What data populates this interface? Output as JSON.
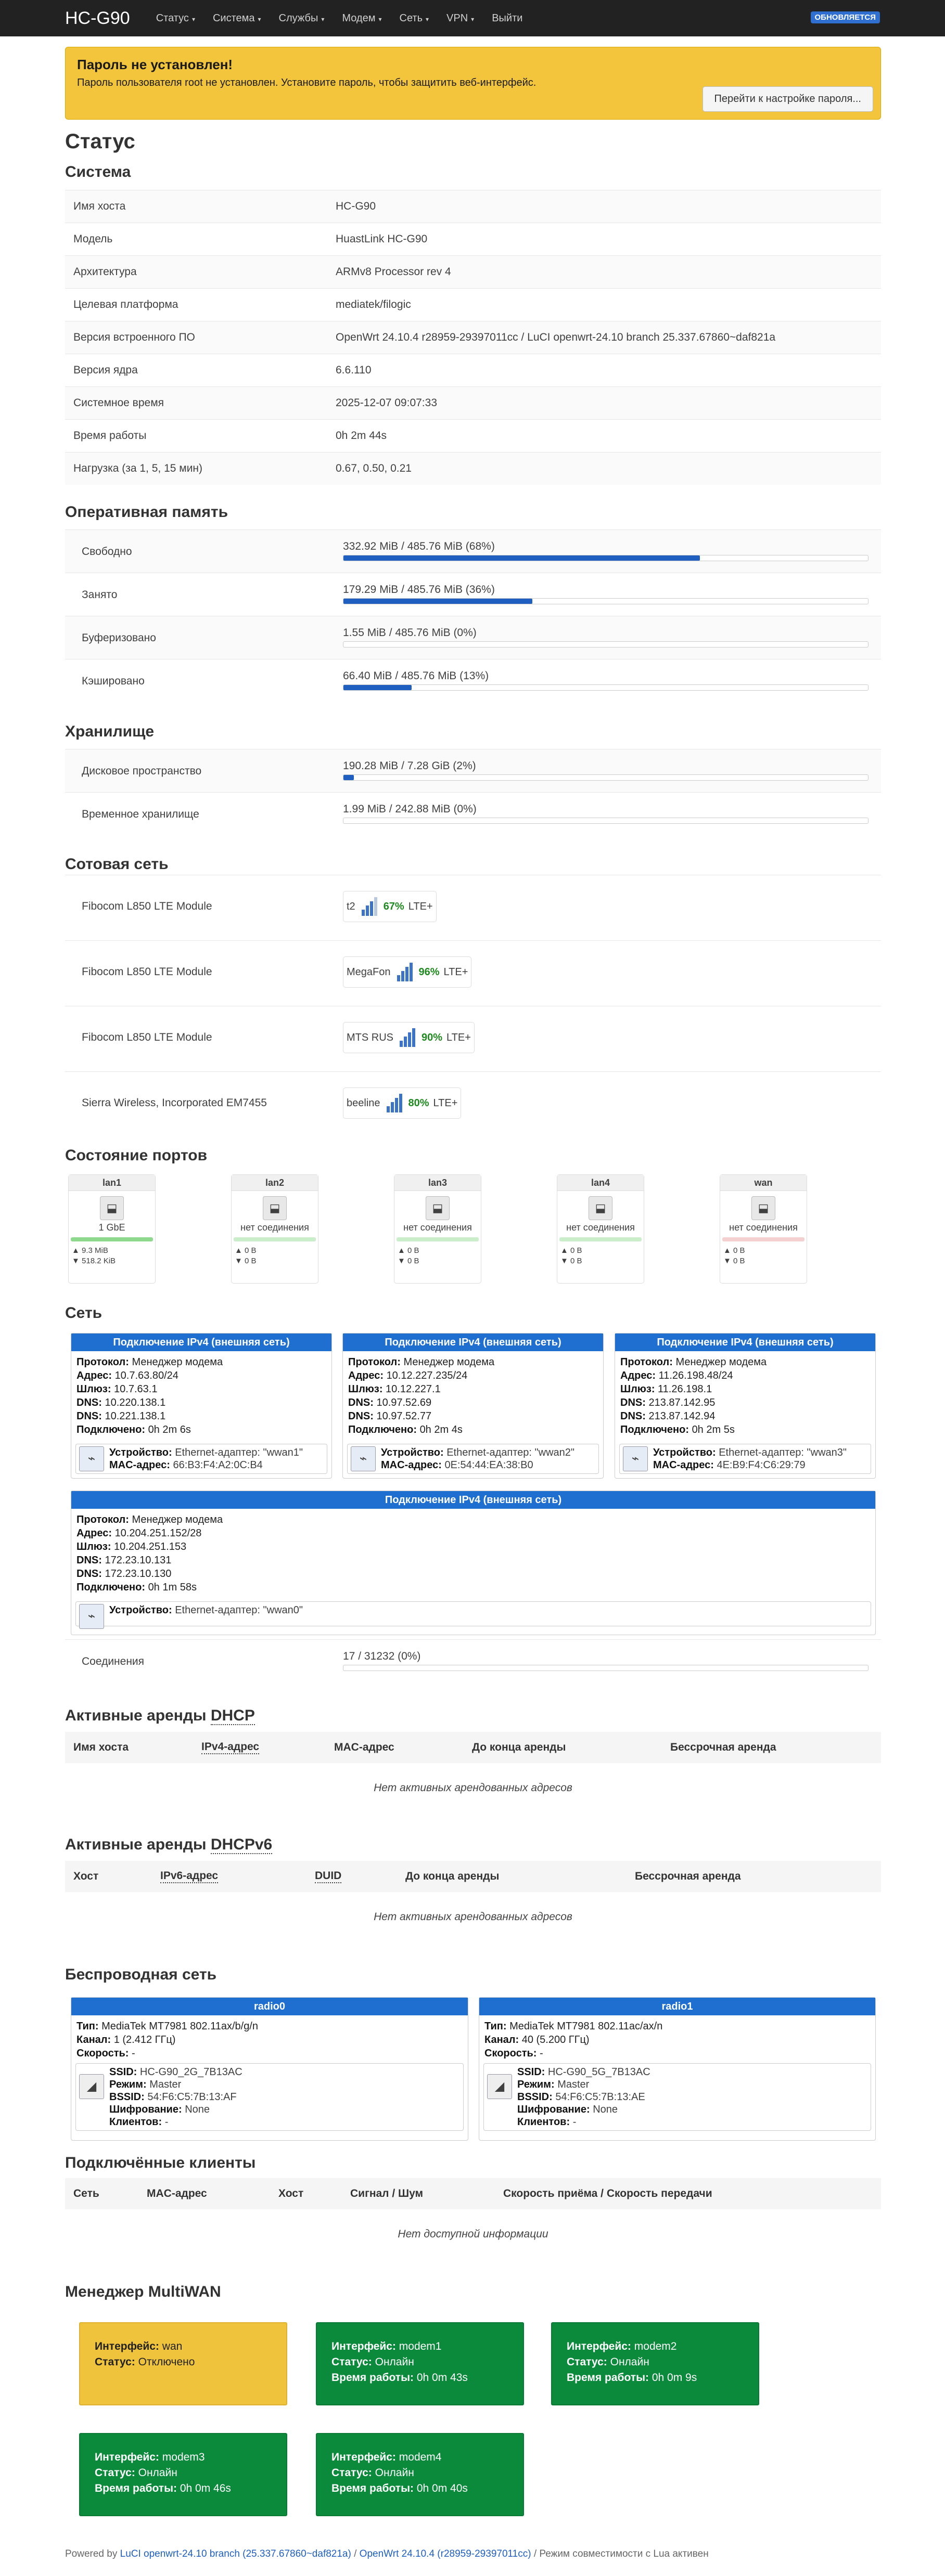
{
  "nav": {
    "brand": "HC-G90",
    "items": [
      "Статус",
      "Система",
      "Службы",
      "Модем",
      "Сеть",
      "VPN",
      "Выйти"
    ],
    "status_badge": "ОБНОВЛЯЕТСЯ"
  },
  "alert": {
    "title": "Пароль не установлен!",
    "text": "Пароль пользователя root не установлен. Установите пароль, чтобы защитить веб-интерфейс.",
    "button": "Перейти к настройке пароля..."
  },
  "page_title": "Статус",
  "system": {
    "heading": "Система",
    "rows": [
      {
        "k": "Имя хоста",
        "v": "HC-G90"
      },
      {
        "k": "Модель",
        "v": "HuastLink HC-G90"
      },
      {
        "k": "Архитектура",
        "v": "ARMv8 Processor rev 4"
      },
      {
        "k": "Целевая платформа",
        "v": "mediatek/filogic"
      },
      {
        "k": "Версия встроенного ПО",
        "v": "OpenWrt 24.10.4 r28959-29397011cc / LuCI openwrt-24.10 branch 25.337.67860~daf821a"
      },
      {
        "k": "Версия ядра",
        "v": "6.6.110"
      },
      {
        "k": "Системное время",
        "v": "2025-12-07 09:07:33"
      },
      {
        "k": "Время работы",
        "v": "0h 2m 44s"
      },
      {
        "k": "Нагрузка (за 1, 5, 15 мин)",
        "v": "0.67, 0.50, 0.21"
      }
    ]
  },
  "memory": {
    "heading": "Оперативная память",
    "rows": [
      {
        "k": "Свободно",
        "v": "332.92 MiB / 485.76 MiB (68%)",
        "pct": 68
      },
      {
        "k": "Занято",
        "v": "179.29 MiB / 485.76 MiB (36%)",
        "pct": 36
      },
      {
        "k": "Буферизовано",
        "v": "1.55 MiB / 485.76 MiB (0%)",
        "pct": 0
      },
      {
        "k": "Кэшировано",
        "v": "66.40 MiB / 485.76 MiB (13%)",
        "pct": 13
      }
    ]
  },
  "storage": {
    "heading": "Хранилище",
    "rows": [
      {
        "k": "Дисковое пространство",
        "v": "190.28 MiB / 7.28 GiB (2%)",
        "pct": 2
      },
      {
        "k": "Временное хранилище",
        "v": "1.99 MiB / 242.88 MiB (0%)",
        "pct": 0
      }
    ]
  },
  "cellular": {
    "heading": "Сотовая сеть",
    "rows": [
      {
        "k": "Fibocom L850 LTE Module",
        "op": "t2",
        "pct": "67%",
        "tech": "LTE+"
      },
      {
        "k": "Fibocom L850 LTE Module",
        "op": "MegaFon",
        "pct": "96%",
        "tech": "LTE+"
      },
      {
        "k": "Fibocom L850 LTE Module",
        "op": "MTS RUS",
        "pct": "90%",
        "tech": "LTE+"
      },
      {
        "k": "Sierra Wireless, Incorporated EM7455",
        "op": "beeline",
        "pct": "80%",
        "tech": "LTE+"
      }
    ]
  },
  "ports": {
    "heading": "Состояние портов",
    "items": [
      {
        "name": "lan1",
        "status": "1 GbE",
        "rx": "▲ 9.3 MiB",
        "tx": "▼ 518.2 KiB",
        "up": true
      },
      {
        "name": "lan2",
        "status": "нет соединения",
        "rx": "▲ 0 B",
        "tx": "▼ 0 B",
        "up": false
      },
      {
        "name": "lan3",
        "status": "нет соединения",
        "rx": "▲ 0 B",
        "tx": "▼ 0 B",
        "up": false
      },
      {
        "name": "lan4",
        "status": "нет соединения",
        "rx": "▲ 0 B",
        "tx": "▼ 0 B",
        "up": false
      },
      {
        "name": "wan",
        "status": "нет соединения",
        "rx": "▲ 0 B",
        "tx": "▼ 0 B",
        "up": false
      }
    ]
  },
  "network": {
    "heading": "Сеть",
    "box_title": "Подключение IPv4 (внешняя сеть)",
    "labels": {
      "proto": "Протокол:",
      "addr": "Адрес:",
      "gw": "Шлюз:",
      "dns": "DNS:",
      "conn": "Подключено:",
      "dev": "Устройство:",
      "mac": "MAC-адрес:"
    },
    "boxes": [
      {
        "proto": "Менеджер модема",
        "addr": "10.7.63.80/24",
        "gw": "10.7.63.1",
        "dns1": "10.220.138.1",
        "dns2": "10.221.138.1",
        "conn": "0h 2m 6s",
        "dev": "Ethernet-адаптер: \"wwan1\"",
        "mac": "66:B3:F4:A2:0C:B4"
      },
      {
        "proto": "Менеджер модема",
        "addr": "10.12.227.235/24",
        "gw": "10.12.227.1",
        "dns1": "10.97.52.69",
        "dns2": "10.97.52.77",
        "conn": "0h 2m 4s",
        "dev": "Ethernet-адаптер: \"wwan2\"",
        "mac": "0E:54:44:EA:38:B0"
      },
      {
        "proto": "Менеджер модема",
        "addr": "11.26.198.48/24",
        "gw": "11.26.198.1",
        "dns1": "213.87.142.95",
        "dns2": "213.87.142.94",
        "conn": "0h 2m 5s",
        "dev": "Ethernet-адаптер: \"wwan3\"",
        "mac": "4E:B9:F4:C6:29:79"
      },
      {
        "proto": "Менеджер модема",
        "addr": "10.204.251.152/28",
        "gw": "10.204.251.153",
        "dns1": "172.23.10.131",
        "dns2": "172.23.10.130",
        "conn": "0h 1m 58s",
        "dev": "Ethernet-адаптер: \"wwan0\"",
        "mac": ""
      }
    ],
    "conn_label": "Соединения",
    "conn_value": "17 / 31232 (0%)",
    "conn_pct": 0
  },
  "dhcp": {
    "heading_pre": "Активные аренды ",
    "heading_abbr": "DHCP",
    "cols": [
      "Имя хоста",
      "IPv4-адрес",
      "MAC-адрес",
      "До конца аренды",
      "Бессрочная аренда"
    ],
    "empty": "Нет активных арендованных адресов"
  },
  "dhcp6": {
    "heading_pre": "Активные аренды ",
    "heading_abbr": "DHCPv6",
    "cols": [
      "Хост",
      "IPv6-адрес",
      "DUID",
      "До конца аренды",
      "Бессрочная аренда"
    ],
    "empty": "Нет активных арендованных адресов"
  },
  "wireless": {
    "heading": "Беспроводная сеть",
    "labels": {
      "type": "Тип:",
      "chan": "Канал:",
      "speed": "Скорость:",
      "ssid": "SSID:",
      "mode": "Режим:",
      "bssid": "BSSID:",
      "enc": "Шифрование:",
      "clients": "Клиентов:"
    },
    "radios": [
      {
        "name": "radio0",
        "type": "MediaTek MT7981 802.11ax/b/g/n",
        "chan": "1 (2.412 ГГц)",
        "speed": "-",
        "ssid": "HC-G90_2G_7B13AC",
        "mode": "Master",
        "bssid": "54:F6:C5:7B:13:AF",
        "enc": "None",
        "clients": "-"
      },
      {
        "name": "radio1",
        "type": "MediaTek MT7981 802.11ac/ax/n",
        "chan": "40 (5.200 ГГц)",
        "speed": "-",
        "ssid": "HC-G90_5G_7B13AC",
        "mode": "Master",
        "bssid": "54:F6:C5:7B:13:AE",
        "enc": "None",
        "clients": "-"
      }
    ]
  },
  "clients": {
    "heading": "Подключённые клиенты",
    "cols": [
      "Сеть",
      "MAC-адрес",
      "Хост",
      "Сигнал / Шум",
      "Скорость приёма / Скорость передачи"
    ],
    "empty": "Нет доступной информации"
  },
  "multiwan": {
    "heading": "Менеджер MultiWAN",
    "labels": {
      "iface": "Интерфейс:",
      "status": "Статус:",
      "uptime": "Время работы:"
    },
    "items": [
      {
        "iface": "wan",
        "status": "Отключено",
        "uptime": "",
        "online": false
      },
      {
        "iface": "modem1",
        "status": "Онлайн",
        "uptime": "0h 0m 43s",
        "online": true
      },
      {
        "iface": "modem2",
        "status": "Онлайн",
        "uptime": "0h 0m 9s",
        "online": true
      },
      {
        "iface": "modem3",
        "status": "Онлайн",
        "uptime": "0h 0m 46s",
        "online": true
      },
      {
        "iface": "modem4",
        "status": "Онлайн",
        "uptime": "0h 0m 40s",
        "online": true
      }
    ]
  },
  "footer": {
    "pre": "Powered by ",
    "link1": "LuCI openwrt-24.10 branch (25.337.67860~daf821a)",
    "sep": " / ",
    "link2": "OpenWrt 24.10.4 (r28959-29397011cc)",
    "post": " / Режим совместимости с Lua активен"
  }
}
